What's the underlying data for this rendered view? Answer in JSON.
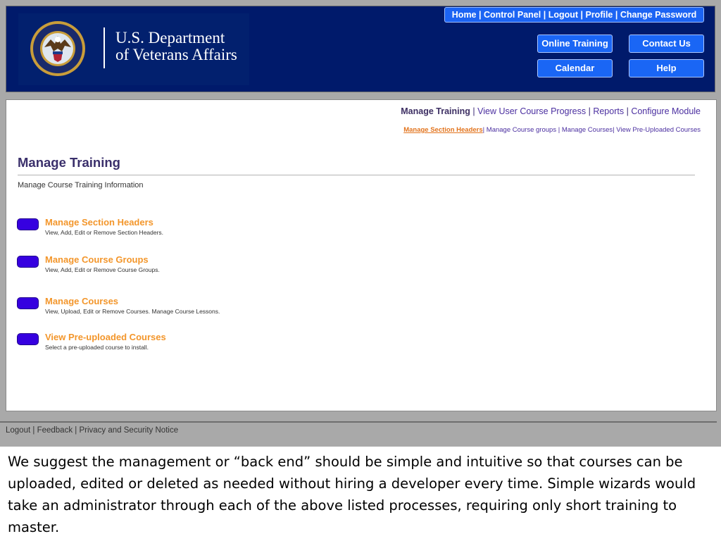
{
  "header": {
    "logo": {
      "line1": "U.S. Department",
      "line2": "of Veterans Affairs",
      "seal_icon": "va-seal-icon"
    },
    "top_links": [
      "Home",
      "Control Panel",
      "Logout",
      "Profile",
      "Change Password"
    ],
    "separator": " | ",
    "buttons": {
      "online_training": "Online Training",
      "contact_us": "Contact Us",
      "calendar": "Calendar",
      "help": "Help"
    },
    "colors": {
      "header_bg": "#001a6b",
      "button_bg": "#1a66f5"
    }
  },
  "subnav": {
    "active": "Manage Training",
    "links": [
      "View User Course Progress",
      "Reports",
      "Configure Module"
    ],
    "secondary": {
      "current": "Manage Section Headers",
      "links": [
        "Manage Course groups",
        "Manage Courses",
        "View Pre-Uploaded Courses"
      ]
    }
  },
  "main": {
    "title": "Manage Training",
    "subtitle": "Manage Course Training Information",
    "items": [
      {
        "title": "Manage Section Headers",
        "desc": "View, Add, Edit or Remove Section Headers."
      },
      {
        "title": "Manage Course Groups",
        "desc": "View, Add, Edit or Remove Course Groups."
      },
      {
        "title": "Manage Courses",
        "desc": "View, Upload, Edit or Remove Courses. Manage Course Lessons."
      },
      {
        "title": "View Pre-uploaded Courses",
        "desc": "Select a pre-uploaded course to install."
      }
    ],
    "colors": {
      "item_title": "#f3962b",
      "pill": "#3600e0",
      "title": "#3a2f6b"
    }
  },
  "footer": {
    "links": [
      "Logout",
      "Feedback",
      "Privacy and Security Notice"
    ]
  },
  "caption": "We suggest the management or “back end” should be simple and intuitive so that courses can be uploaded, edited or deleted as needed without hiring a developer every time. Simple wizards would take an administrator through each of the above listed processes, requiring only short training to master."
}
